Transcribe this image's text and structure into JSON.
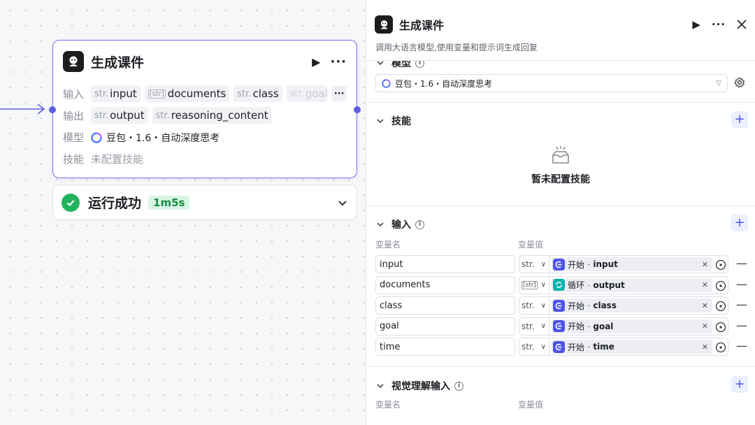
{
  "node": {
    "title": "生成课件",
    "input_label": "输入",
    "output_label": "输出",
    "model_label": "模型",
    "skill_label": "技能",
    "inputs": [
      {
        "type": "str.",
        "name": "input"
      },
      {
        "type": "[str]",
        "name": "documents"
      },
      {
        "type": "str.",
        "name": "class"
      },
      {
        "type": "str.",
        "name": "goal"
      }
    ],
    "outputs": [
      {
        "type": "str.",
        "name": "output"
      },
      {
        "type": "str.",
        "name": "reasoning_content"
      }
    ],
    "model_value": "豆包・1.6・自动深度思考",
    "skill_value": "未配置技能"
  },
  "status": {
    "text": "运行成功",
    "duration": "1m5s"
  },
  "panel": {
    "title": "生成课件",
    "description": "调用大语言模型,使用变量和提示词生成回复",
    "model_section": "模型",
    "model_value": "豆包・1.6・自动深度思考",
    "skills_section": "技能",
    "skills_empty": "暂未配置技能",
    "input_section": "输入",
    "col_name": "变量名",
    "col_value": "变量值",
    "variables": [
      {
        "name": "input",
        "type": "str.",
        "source": "开始",
        "var": "input",
        "source_kind": "start"
      },
      {
        "name": "documents",
        "type": "[str]",
        "source": "循环",
        "var": "output",
        "source_kind": "loop"
      },
      {
        "name": "class",
        "type": "str.",
        "source": "开始",
        "var": "class",
        "source_kind": "start"
      },
      {
        "name": "goal",
        "type": "str.",
        "source": "开始",
        "var": "goal",
        "source_kind": "start"
      },
      {
        "name": "time",
        "type": "str.",
        "source": "开始",
        "var": "time",
        "source_kind": "start"
      }
    ],
    "vision_section": "视觉理解输入",
    "vision_col_name": "变量名",
    "vision_col_value": "变量值"
  },
  "icons": {
    "logo": "bot-logo-icon",
    "run": "play-icon",
    "more": "more-dots-icon",
    "close": "close-icon",
    "success": "check-circle-icon",
    "expand": "chevron-down-icon"
  },
  "colors": {
    "accent": "#4d53e8",
    "node_border": "#7b6ff0",
    "success": "#22b35e",
    "loop": "#00b2b2"
  }
}
